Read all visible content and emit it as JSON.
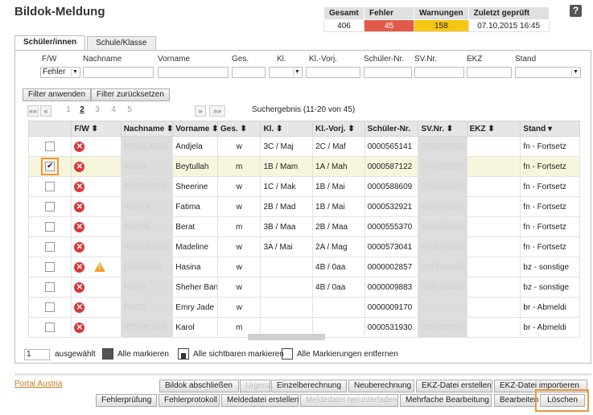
{
  "header": {
    "title": "Bildok-Meldung",
    "help": "?"
  },
  "summary": {
    "headers": [
      "Gesamt",
      "Fehler",
      "Warnungen",
      "Zuletzt geprüft"
    ],
    "values": [
      "406",
      "45",
      "158",
      "07.10.2015 16:45"
    ],
    "colors": {
      "fehler": "#e25b4a",
      "warnungen": "#f7c614"
    }
  },
  "tabs": [
    "Schüler/innen",
    "Schule/Klasse"
  ],
  "filters": {
    "labels": [
      "F/W",
      "Nachname",
      "Vorname",
      "Ges.",
      "Kl.",
      "Kl.-Vorj.",
      "Schüler-Nr.",
      "SV.Nr.",
      "EKZ",
      "Stand"
    ],
    "fw_value": "Fehler"
  },
  "filter_buttons": {
    "apply": "Filter anwenden",
    "reset": "Filter zurücksetzen"
  },
  "pager": {
    "first": "««",
    "prev": "«",
    "pages": [
      "1",
      "2",
      "3",
      "4",
      "5"
    ],
    "current": "2",
    "next": "»",
    "last": "»»",
    "result": "Suchergebnis (11-20 von 45)"
  },
  "grid": {
    "headers": [
      "F/W ⬍",
      "Nachname ⬍",
      "Vorname ⬍",
      "Ges. ⬍",
      "Kl. ⬍",
      "Kl.-Vorj. ⬍",
      "Schüler-Nr.",
      "SV.Nr. ⬍",
      "EKZ ⬍",
      "Stand ▾"
    ],
    "rows": [
      {
        "checked": false,
        "warn": false,
        "nachname": "NIKOLANDI",
        "vorname": "Andjela",
        "ges": "w",
        "kl": "3C / Maj",
        "klvorj": "2C / Maf",
        "nr": "0000565141",
        "svnr": "0938280501",
        "ekz": "",
        "stand": "fn - Fortsetz"
      },
      {
        "checked": true,
        "warn": false,
        "nachname": "Baalla",
        "vorname": "Beytullah",
        "ges": "m",
        "kl": "1B / Mam",
        "klvorj": "1A / Mah",
        "nr": "0000587122",
        "svnr": "3748221201",
        "ekz": "",
        "stand": "fn - Fortsetz"
      },
      {
        "checked": false,
        "warn": false,
        "nachname": "THOMPSON",
        "vorname": "Sheerine",
        "ges": "w",
        "kl": "1C / Mak",
        "klvorj": "1B / Mai",
        "nr": "0000588609",
        "svnr": "3654110901",
        "ekz": "",
        "stand": "fn - Fortsetz"
      },
      {
        "checked": false,
        "warn": false,
        "nachname": "VIDEDI",
        "vorname": "Fatima",
        "ges": "w",
        "kl": "2B / Mad",
        "klvorj": "1B / Mai",
        "nr": "0000532921",
        "svnr": "4248171001",
        "ekz": "",
        "stand": "fn - Fortsetz"
      },
      {
        "checked": false,
        "warn": false,
        "nachname": "YURAL",
        "vorname": "Berat",
        "ges": "m",
        "kl": "3B / Maa",
        "klvorj": "2B / Maa",
        "nr": "0000555370",
        "svnr": "4068280801",
        "ekz": "",
        "stand": "fn - Fortsetz"
      },
      {
        "checked": false,
        "warn": false,
        "nachname": "WATERMAN",
        "vorname": "Madeline",
        "ges": "w",
        "kl": "3A / Mai",
        "klvorj": "2A / Mag",
        "nr": "0000573041",
        "svnr": "4706150301",
        "ekz": "",
        "stand": "fn - Fortsetz"
      },
      {
        "checked": false,
        "warn": true,
        "nachname": "CHAIBANI",
        "vorname": "Hasina",
        "ges": "w",
        "kl": "",
        "klvorj": "4B / 0aa",
        "nr": "0000002857",
        "svnr": "4517150301",
        "ekz": "",
        "stand": "bz - sonstige"
      },
      {
        "checked": false,
        "warn": false,
        "nachname": "KHAN",
        "vorname": "Sheher Ban",
        "ges": "w",
        "kl": "",
        "klvorj": "4B / 0aa",
        "nr": "0000009883",
        "svnr": "3441103402",
        "ekz": "",
        "stand": "bz - sonstige"
      },
      {
        "checked": false,
        "warn": false,
        "nachname": "FROE",
        "vorname": "Emry Jade",
        "ges": "w",
        "kl": "",
        "klvorj": "",
        "nr": "0000009170",
        "svnr": "",
        "ekz": "",
        "stand": "br - Abmeldi"
      },
      {
        "checked": false,
        "warn": false,
        "nachname": "SZYMCZAK",
        "vorname": "Karol",
        "ges": "m",
        "kl": "",
        "klvorj": "",
        "nr": "0000531930",
        "svnr": "3758280601",
        "ekz": "",
        "stand": "br - Abmeldi"
      }
    ]
  },
  "selection": {
    "count": "1",
    "label": "ausgewählt",
    "mark_all": "Alle markieren",
    "mark_visible": "Alle sichtbaren markieren",
    "unmark_all": "Alle Markierungen entfernen"
  },
  "footer": {
    "portal": "Portal Austria",
    "row1": [
      "Bildok abschließen",
      "Urgenz",
      "Einzelberechnung",
      "Neuberechnung",
      "EKZ-Datei erstellen",
      "EKZ-Datei importieren"
    ],
    "row2": [
      "Fehlerprüfung",
      "Fehlerprotokoll",
      "Meldedatei erstellen",
      "Meldedatei herunterladen",
      "Mehrfache Bearbeitung",
      "Bearbeiten",
      "Löschen"
    ]
  },
  "icons": {
    "error": "error-x-icon",
    "warning": "warning-triangle-icon",
    "sort": "sort-icon",
    "dropdown": "chevron-down-icon"
  }
}
